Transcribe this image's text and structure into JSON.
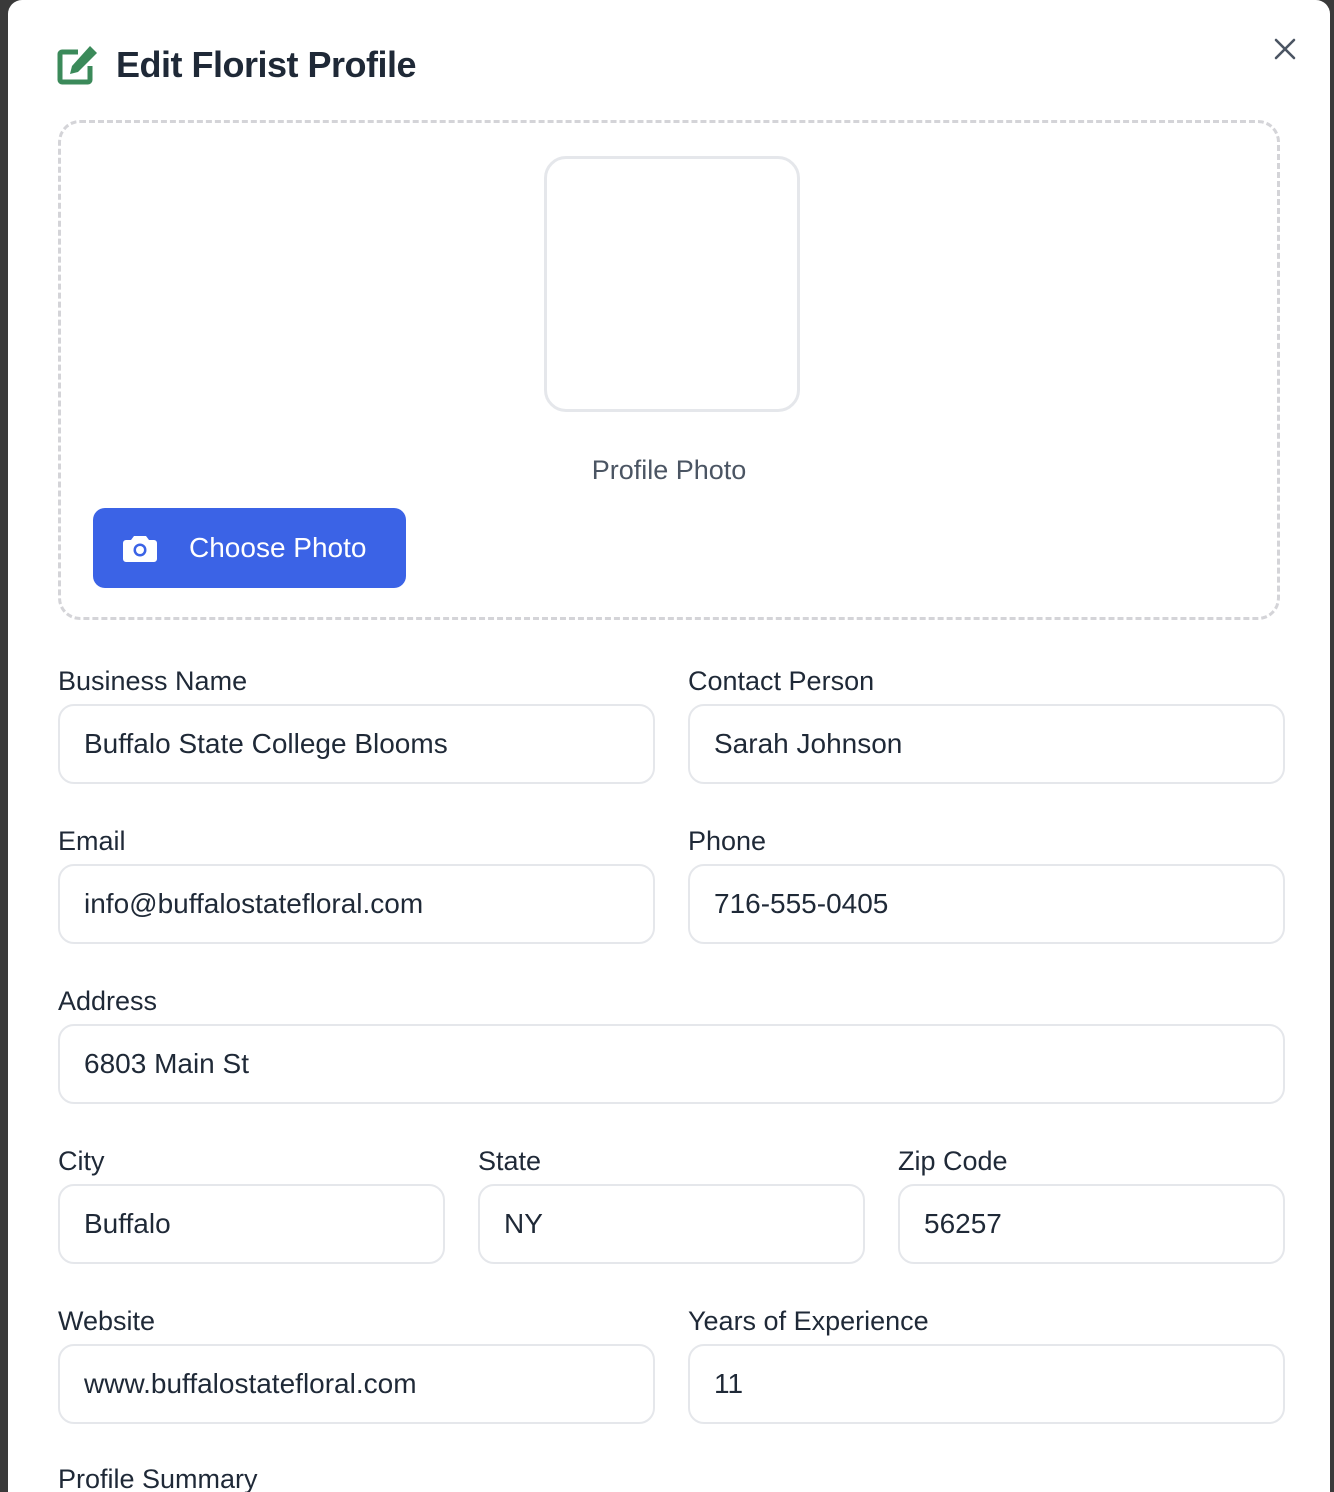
{
  "dialog": {
    "title": "Edit Florist Profile",
    "accent_color": "#3b8a5a",
    "primary_color": "#3b63e6"
  },
  "photo": {
    "label": "Profile Photo",
    "button_label": "Choose Photo"
  },
  "fields": {
    "business_name": {
      "label": "Business Name",
      "value": "Buffalo State College Blooms"
    },
    "contact_person": {
      "label": "Contact Person",
      "value": "Sarah Johnson"
    },
    "email": {
      "label": "Email",
      "value": "info@buffalostatefloral.com"
    },
    "phone": {
      "label": "Phone",
      "value": "716-555-0405"
    },
    "address": {
      "label": "Address",
      "value": "6803 Main St"
    },
    "city": {
      "label": "City",
      "value": "Buffalo"
    },
    "state": {
      "label": "State",
      "value": "NY"
    },
    "zip": {
      "label": "Zip Code",
      "value": "56257"
    },
    "website": {
      "label": "Website",
      "value": "www.buffalostatefloral.com"
    },
    "experience": {
      "label": "Years of Experience",
      "value": "11"
    },
    "summary": {
      "label": "Profile Summary"
    }
  }
}
